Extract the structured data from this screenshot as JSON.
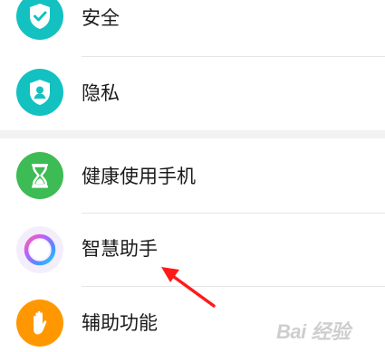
{
  "settings": {
    "items": [
      {
        "label": "安全",
        "icon": "shield-check-icon",
        "icon_color": "#13c1c1"
      },
      {
        "label": "隐私",
        "icon": "privacy-shield-person-icon",
        "icon_color": "#13c1c1"
      },
      {
        "label": "健康使用手机",
        "icon": "hourglass-icon",
        "icon_color": "#3dbb54"
      },
      {
        "label": "智慧助手",
        "icon": "smart-assistant-ring-icon",
        "icon_color": "#b463ff"
      },
      {
        "label": "辅助功能",
        "icon": "hand-icon",
        "icon_color": "#ff9800"
      }
    ]
  },
  "annotation": {
    "arrow_color": "#ff1a1a"
  },
  "watermark": {
    "text": "Bai 经验",
    "brand_color": "#bdbdbd"
  }
}
